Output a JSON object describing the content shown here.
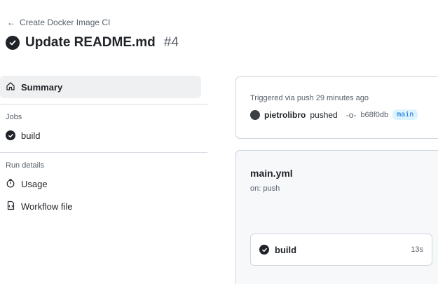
{
  "header": {
    "back_label": "Create Docker Image CI",
    "title": "Update README.md",
    "run_number": "#4"
  },
  "sidebar": {
    "summary_label": "Summary",
    "jobs_section": "Jobs",
    "jobs": [
      {
        "label": "build",
        "status": "success"
      }
    ],
    "run_details_section": "Run details",
    "usage_label": "Usage",
    "workflow_file_label": "Workflow file"
  },
  "trigger": {
    "label": "Triggered via push 29 minutes ago",
    "actor": "pietrolibro",
    "action": "pushed",
    "sha": "b68f0db",
    "branch": "main"
  },
  "workflow": {
    "name": "main.yml",
    "on": "on: push",
    "job": {
      "name": "build",
      "duration": "13s",
      "status": "success"
    }
  },
  "colors": {
    "text": "#1f2328",
    "muted": "#57606a",
    "border": "#d0d7de",
    "selected_bg": "#eef0f2",
    "branch_bg": "#ddf4ff",
    "branch_fg": "#0969da",
    "panel_bg": "#f6f8fa"
  },
  "icons": [
    "arrow-left-icon",
    "check-circle-icon",
    "home-icon",
    "stopwatch-icon",
    "file-code-icon",
    "git-commit-icon"
  ]
}
